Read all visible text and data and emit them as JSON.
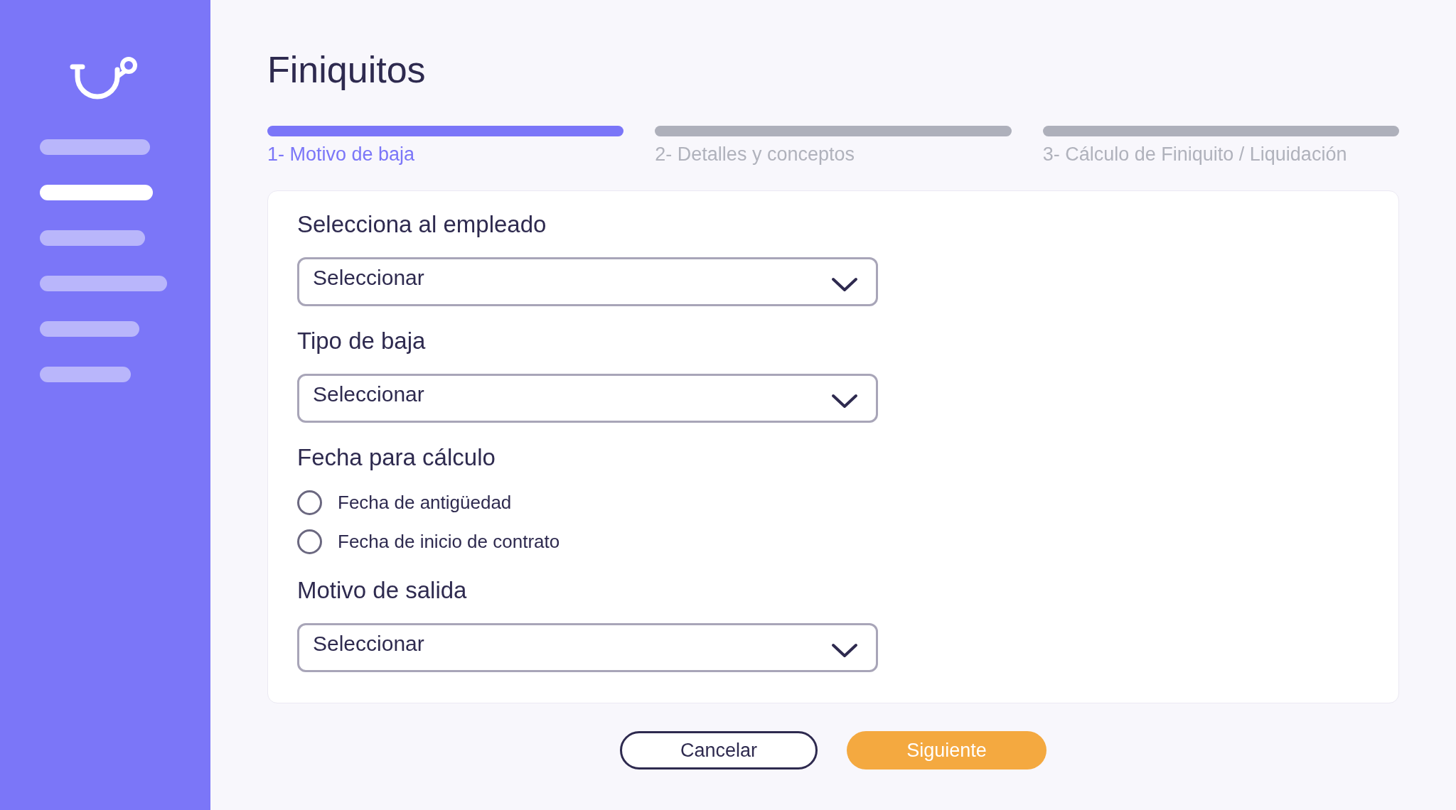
{
  "sidebar": {
    "items": [
      {
        "selected": false
      },
      {
        "selected": true
      },
      {
        "selected": false
      },
      {
        "selected": false
      },
      {
        "selected": false
      },
      {
        "selected": false
      }
    ]
  },
  "title": "Finiquitos",
  "steps": [
    {
      "label": "1- Motivo de baja",
      "selected": true
    },
    {
      "label": "2- Detalles y conceptos",
      "selected": false
    },
    {
      "label": "3- Cálculo de Finiquito / Liquidación",
      "selected": false
    }
  ],
  "form": [
    {
      "kind": "select",
      "label": "Selecciona al empleado",
      "value": "Seleccionar"
    },
    {
      "kind": "select",
      "label": "Tipo de baja",
      "value": "Seleccionar"
    },
    {
      "kind": "radio_group",
      "label": "Fecha para cálculo",
      "options": [
        {
          "label": "Fecha de antigüedad",
          "checked": false
        },
        {
          "label": "Fecha de inicio de contrato",
          "checked": false
        }
      ]
    },
    {
      "kind": "select",
      "label": "Motivo de salida",
      "value": "Seleccionar"
    }
  ],
  "buttons": [
    {
      "kind": "secondary",
      "label": "Cancelar"
    },
    {
      "kind": "primary",
      "label": "Siguiente"
    }
  ]
}
